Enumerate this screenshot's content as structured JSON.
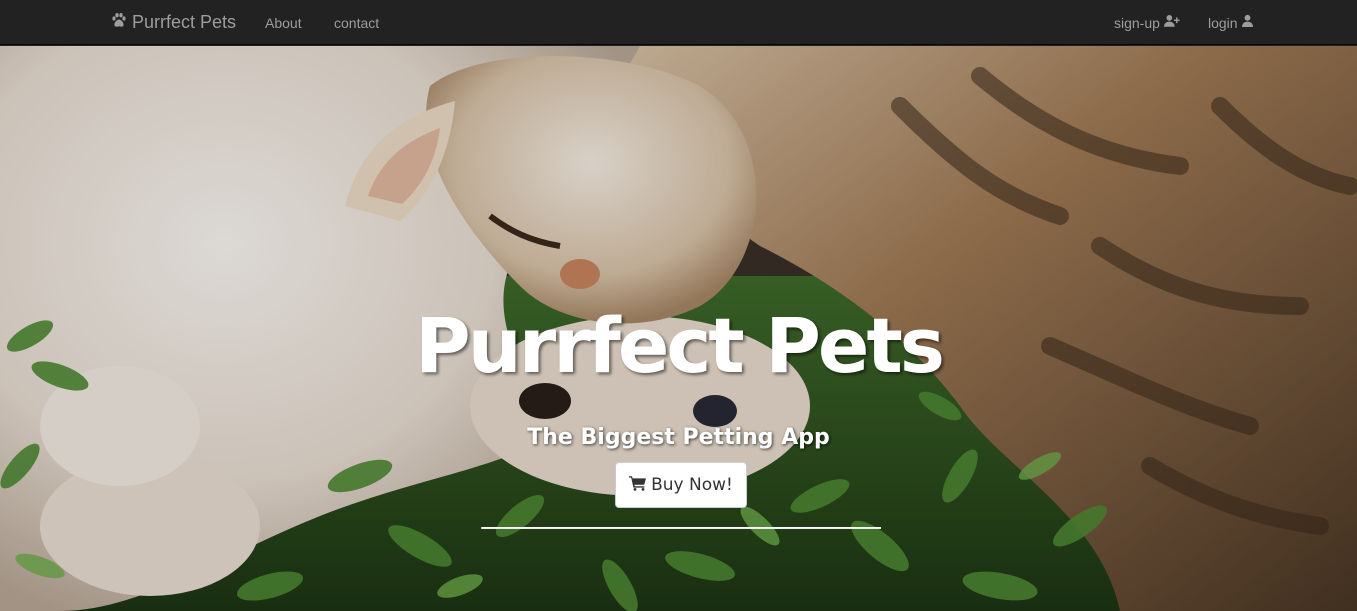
{
  "navbar": {
    "brand": {
      "label": "Purrfect Pets",
      "icon": "paw-icon"
    },
    "links": [
      {
        "label": "About"
      },
      {
        "label": "contact"
      }
    ],
    "right_links": [
      {
        "label": "sign-up",
        "icon": "user-plus-icon"
      },
      {
        "label": "login",
        "icon": "user-icon"
      }
    ]
  },
  "hero": {
    "title": "Purrfect Pets",
    "subtitle": "The Biggest Petting App",
    "button": {
      "label": "Buy Now!",
      "icon": "shopping-cart-icon"
    }
  },
  "colors": {
    "navbar_bg": "#222222",
    "nav_text": "#9d9d9d",
    "hero_text": "#ffffff",
    "button_bg": "#ffffff",
    "button_text": "#333333"
  }
}
